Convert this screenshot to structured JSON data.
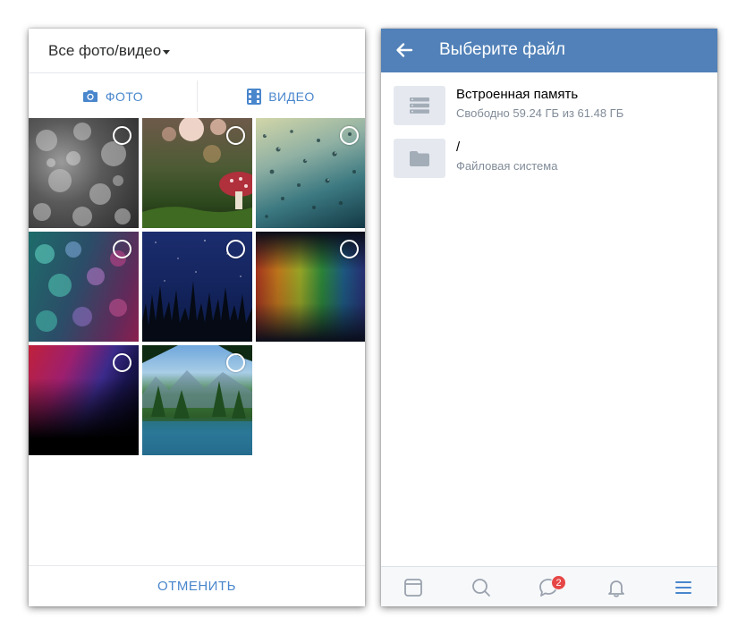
{
  "left_screen": {
    "album_selector": "Все фото/видео",
    "tabs": [
      {
        "label": "ФОТО",
        "icon": "camera-icon"
      },
      {
        "label": "ВИДЕО",
        "icon": "film-icon"
      }
    ],
    "thumbnails": [
      {
        "description_icon": "android-bokeh-gray"
      },
      {
        "description_icon": "mushroom-bokeh"
      },
      {
        "description_icon": "raindrops-teal"
      },
      {
        "description_icon": "android-bokeh-color"
      },
      {
        "description_icon": "night-grass"
      },
      {
        "description_icon": "aurora-lights"
      },
      {
        "description_icon": "rainbow-rays"
      },
      {
        "description_icon": "forest-lake"
      }
    ],
    "cancel_label": "ОТМЕНИТЬ"
  },
  "right_screen": {
    "title": "Выберите файл",
    "items": [
      {
        "name": "Встроенная память",
        "subtitle": "Свободно 59.24 ГБ из 61.48 ГБ",
        "icon": "storage-icon"
      },
      {
        "name": "/",
        "subtitle": "Файловая система",
        "icon": "folder-icon"
      }
    ],
    "bottom_nav": [
      {
        "icon": "news-icon"
      },
      {
        "icon": "search-icon"
      },
      {
        "icon": "messages-icon",
        "badge": "2"
      },
      {
        "icon": "bell-icon"
      },
      {
        "icon": "menu-icon"
      }
    ]
  },
  "colors": {
    "accent": "#4986cc",
    "header": "#5181b8",
    "badge": "#e64646"
  }
}
